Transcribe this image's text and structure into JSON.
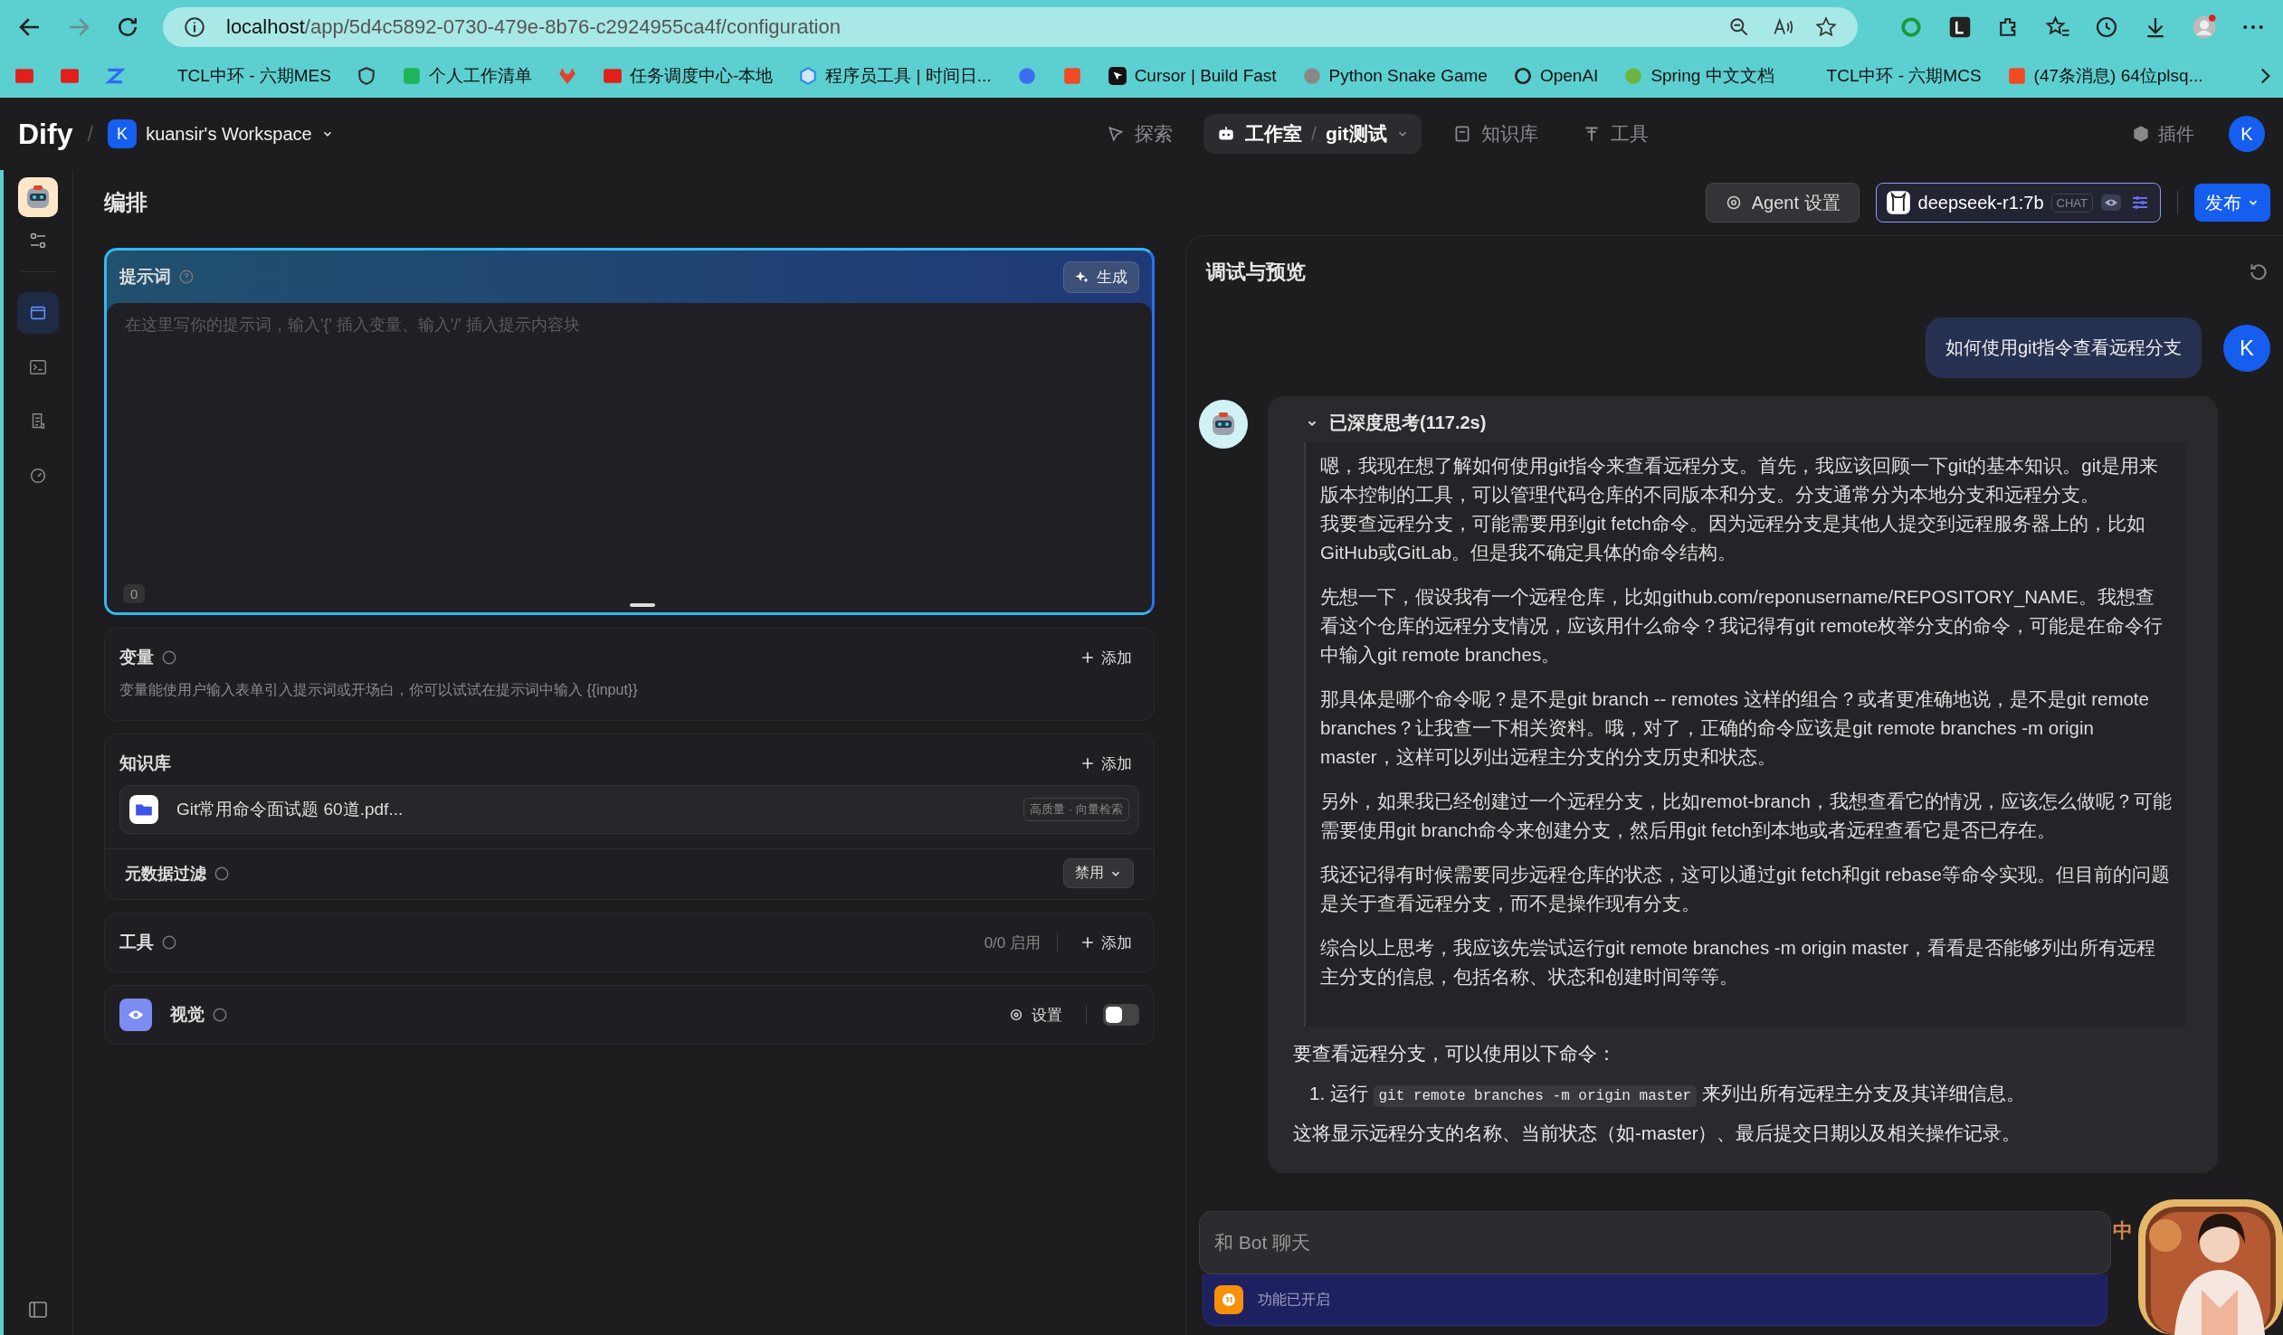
{
  "browser": {
    "url_host": "localhost",
    "url_path": "/app/5d4c5892-0730-479e-8b76-c2924955ca4f/configuration",
    "bookmarks": [
      {
        "kind": "tcl"
      },
      {
        "kind": "tcl"
      },
      {
        "kind": "z"
      },
      {
        "kind": "blank",
        "label": "TCL中环 - 六期MES"
      },
      {
        "kind": "shield"
      },
      {
        "kind": "list",
        "label": "个人工作清单"
      },
      {
        "kind": "fox"
      },
      {
        "kind": "tcl",
        "label": "任务调度中心-本地"
      },
      {
        "kind": "cube",
        "label": "程序员工具 | 时间日..."
      },
      {
        "kind": "if"
      },
      {
        "kind": "c"
      },
      {
        "kind": "cursor",
        "label": "Cursor | Build Fast"
      },
      {
        "kind": "globe",
        "label": "Python Snake Game"
      },
      {
        "kind": "openai",
        "label": "OpenAI"
      },
      {
        "kind": "spring",
        "label": "Spring 中文文档"
      },
      {
        "kind": "blank",
        "label": "TCL中环 - 六期MCS"
      },
      {
        "kind": "c",
        "label": "(47条消息) 64位plsq..."
      }
    ]
  },
  "header": {
    "logo": "Dify",
    "separator": "/",
    "workspace_avatar": "K",
    "workspace": "kuansir's Workspace",
    "nav": [
      {
        "kind": "explore",
        "label": "探索",
        "selected": false
      },
      {
        "kind": "studio",
        "label": "工作室",
        "crumb_separator": "/",
        "crumb": "git测试",
        "selected": true
      },
      {
        "kind": "knowledge",
        "label": "知识库",
        "selected": false
      },
      {
        "kind": "tools",
        "label": "工具",
        "selected": false
      }
    ],
    "plugins": "插件",
    "avatar": "K"
  },
  "rail": [
    {
      "kind": "orchestrate",
      "selected": true
    },
    {
      "kind": "terminal",
      "selected": false
    },
    {
      "kind": "logs",
      "selected": false
    },
    {
      "kind": "monitor",
      "selected": false
    }
  ],
  "editor": {
    "title": "编排",
    "prompt": {
      "title": "提示词",
      "generate": "生成",
      "placeholder": "在这里写你的提示词，输入'{' 插入变量、输入'/' 插入提示内容块",
      "count": "0"
    },
    "variables": {
      "title": "变量",
      "add": "添加",
      "description": "变量能使用户输入表单引入提示词或开场白，你可以试试在提示词中输入 {{input}}"
    },
    "knowledge": {
      "title": "知识库",
      "add": "添加",
      "items": [
        {
          "name": "Git常用命令面试题 60道.pdf...",
          "tag": "高质量 · 向量检索"
        }
      ],
      "filter_label": "元数据过滤",
      "filter_value": "禁用"
    },
    "tools": {
      "title": "工具",
      "count": "0/0 启用",
      "add": "添加"
    },
    "vision": {
      "title": "视觉",
      "settings": "设置",
      "on": false
    }
  },
  "toolbar": {
    "agent_settings": "Agent 设置",
    "model": "deepseek-r1:7b",
    "model_badge": "CHAT",
    "publish": "发布"
  },
  "preview": {
    "title": "调试与预览",
    "user_message": "如何使用git指令查看远程分支",
    "user_avatar": "K",
    "thinking": {
      "title": "已深度思考(117.2s)",
      "expanded": true,
      "paragraphs": [
        [
          "嗯，我现在想了解如何使用git指令来查看远程分支。首先，我应该回顾一下git的基本知识。git是用来版本控制的工具，可以管理代码仓库的不同版本和分支。分支通常分为本地分支和远程分支。",
          "我要查远程分支，可能需要用到git fetch命令。因为远程分支是其他人提交到远程服务器上的，比如GitHub或GitLab。但是我不确定具体的命令结构。"
        ],
        [
          "先想一下，假设我有一个远程仓库，比如github.com/reponusername/REPOSITORY_NAME。我想查看这个仓库的远程分支情况，应该用什么命令？我记得有git remote枚举分支的命令，可能是在命令行中输入git remote branches。"
        ],
        [
          "那具体是哪个命令呢？是不是git branch -- remotes 这样的组合？或者更准确地说，是不是git remote branches？让我查一下相关资料。哦，对了，正确的命令应该是git remote branches -m origin master，这样可以列出远程主分支的分支历史和状态。"
        ],
        [
          "另外，如果我已经创建过一个远程分支，比如remot-branch，我想查看它的情况，应该怎么做呢？可能需要使用git branch命令来创建分支，然后用git fetch到本地或者远程查看它是否已存在。"
        ],
        [
          "我还记得有时候需要同步远程仓库的状态，这可以通过git fetch和git rebase等命令实现。但目前的问题是关于查看远程分支，而不是操作现有分支。"
        ],
        [
          "综合以上思考，我应该先尝试运行git remote branches -m origin master，看看是否能够列出所有远程主分支的信息，包括名称、状态和创建时间等等。"
        ]
      ]
    },
    "answer_intro": "要查看远程分支，可以使用以下命令：",
    "steps": [
      {
        "number": "1.",
        "before": "运行",
        "code": "git remote branches -m origin master",
        "after": "来列出所有远程主分支及其详细信息。"
      }
    ],
    "answer_outro": "这将显示远程分支的名称、当前状态（如-master）、最后提交日期以及相关操作记录。",
    "input_placeholder": "和 Bot 聊天",
    "features": "功能已开启"
  },
  "ime": {
    "mode": "中"
  }
}
